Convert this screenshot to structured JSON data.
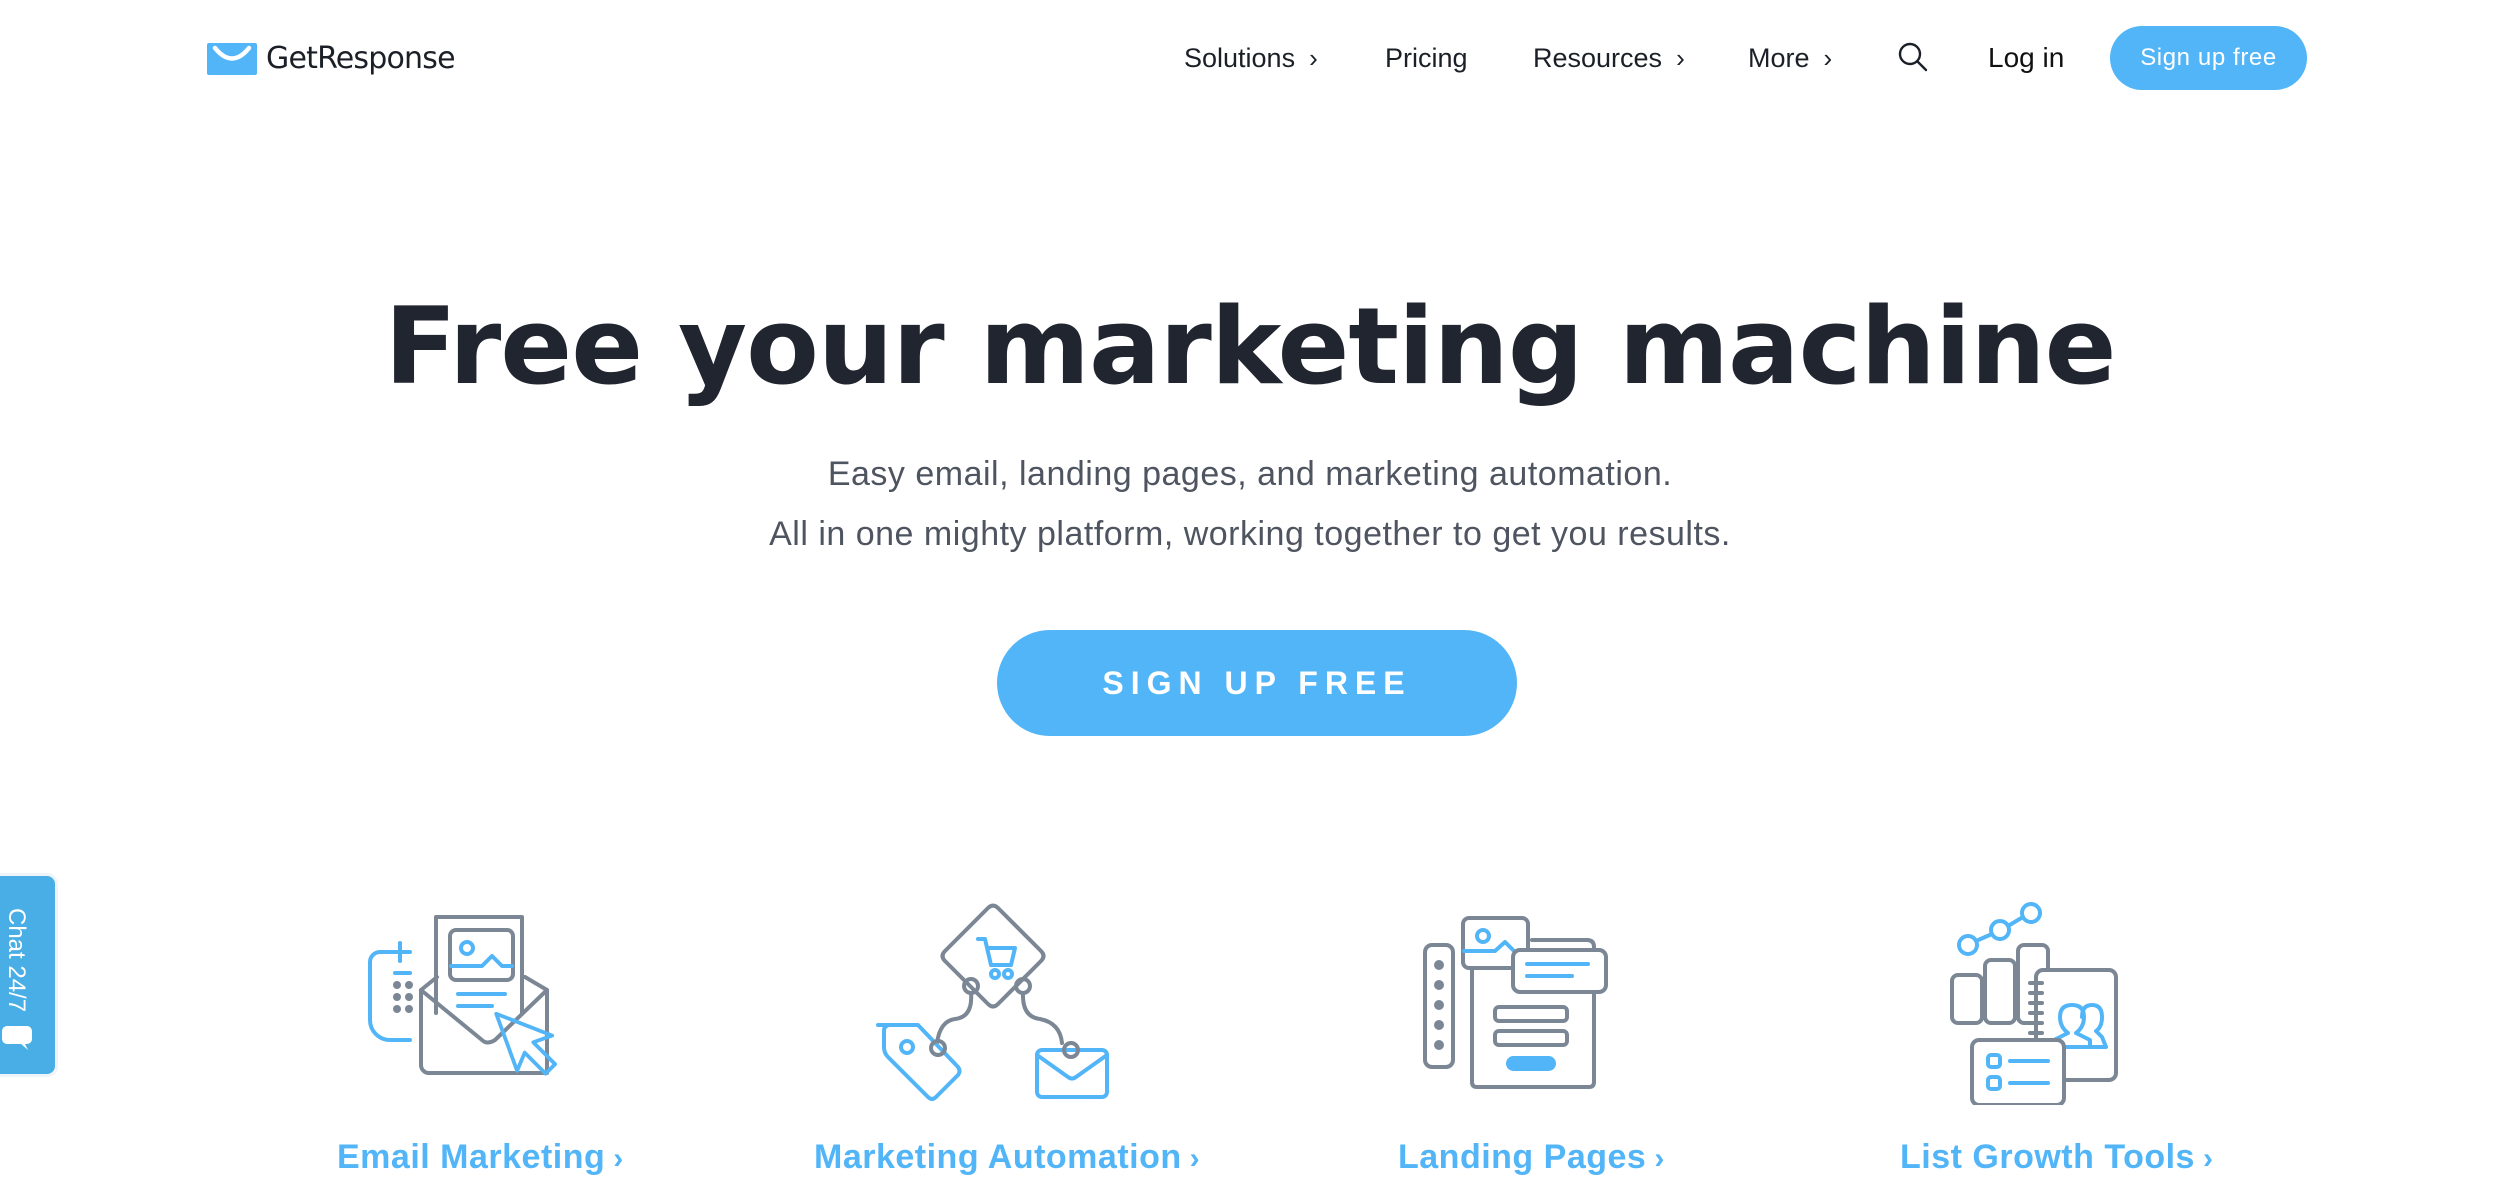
{
  "brand": {
    "name": "GetResponse",
    "logo_icon": "envelope-smile-icon",
    "accent_color": "#52b5f8",
    "text_color": "#202530"
  },
  "nav": {
    "items": [
      {
        "label": "Solutions",
        "has_submenu": true,
        "icon": "chevron-right-icon"
      },
      {
        "label": "Pricing",
        "has_submenu": false
      },
      {
        "label": "Resources",
        "has_submenu": true,
        "icon": "chevron-right-icon"
      },
      {
        "label": "More",
        "has_submenu": true,
        "icon": "chevron-right-icon"
      }
    ],
    "chevron": "›",
    "search_icon": "search-icon",
    "login_label": "Log in",
    "signup_label": "Sign up free"
  },
  "hero": {
    "title": "Free your marketing machine",
    "subtitle_line1": "Easy email, landing pages, and marketing automation.",
    "subtitle_line2": "All in one mighty platform, working together to get you results.",
    "cta_label": "SIGN UP FREE"
  },
  "features": [
    {
      "label": "Email Marketing",
      "icon": "email-marketing-icon"
    },
    {
      "label": "Marketing Automation",
      "icon": "marketing-automation-icon"
    },
    {
      "label": "Landing Pages",
      "icon": "landing-pages-icon"
    },
    {
      "label": "List Growth Tools",
      "icon": "list-growth-tools-icon"
    }
  ],
  "chat": {
    "label": "Chat 24/7",
    "icon": "chat-bubble-icon"
  }
}
